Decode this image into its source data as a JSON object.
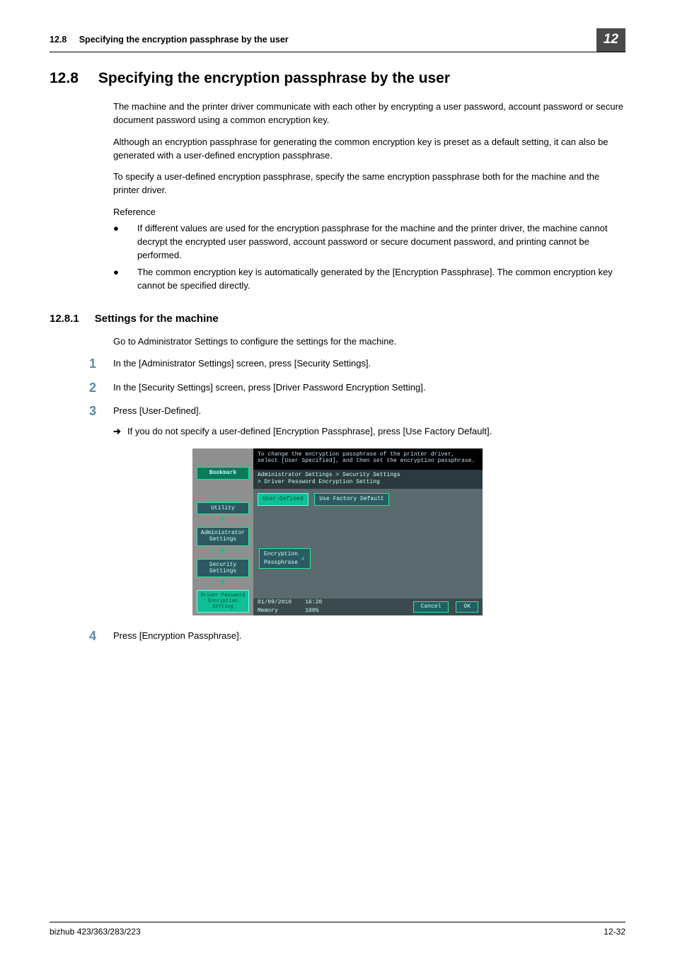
{
  "header": {
    "section_number": "12.8",
    "running_title": "Specifying the encryption passphrase by the user",
    "chapter_badge": "12"
  },
  "h1": {
    "number": "12.8",
    "title": "Specifying the encryption passphrase by the user"
  },
  "intro": {
    "p1": "The machine and the printer driver communicate with each other by encrypting a user password, account password or secure document password using a common encryption key.",
    "p2": "Although an encryption passphrase for generating the common encryption key is preset as a default setting, it can also be generated with a user-defined encryption passphrase.",
    "p3": "To specify a user-defined encryption passphrase, specify the same encryption passphrase both for the machine and the printer driver.",
    "ref_label": "Reference",
    "bullets": [
      "If different values are used for the encryption passphrase for the machine and the printer driver, the machine cannot decrypt the encrypted user password, account password or secure document password, and printing cannot be performed.",
      "The common encryption key is automatically generated by the [Encryption Passphrase]. The common encryption key cannot be specified directly."
    ]
  },
  "h2": {
    "number": "12.8.1",
    "title": "Settings for the machine",
    "lead": "Go to Administrator Settings to configure the settings for the machine."
  },
  "steps": {
    "s1": "In the [Administrator Settings] screen, press [Security Settings].",
    "s2": "In the [Security Settings] screen, press [Driver Password Encryption Setting].",
    "s3": "Press [User-Defined].",
    "s3_sub": "If you do not specify a user-defined [Encryption Passphrase], press [Use Factory Default].",
    "s4": "Press [Encryption Passphrase]."
  },
  "device": {
    "hint_line1": "To change the encryption passphrase of the printer driver,",
    "hint_line2": "select [User Specified], and then set the encryption passphrase.",
    "bookmark": "Bookmark",
    "crumbs": {
      "utility": "Utility",
      "admin": "Administrator\nSettings",
      "security": "Security\nSettings",
      "driver": "Driver Password\nEncryption\nSetting"
    },
    "breadcrumb_line1": "Administrator Settings > Security Settings",
    "breadcrumb_line2": "> Driver Password Encryption Setting",
    "btn_user_defined": "User-Defined",
    "btn_factory": "Use Factory Default",
    "btn_encryption": "Encryption\nPassphrase",
    "footer_date": "01/09/2010",
    "footer_time": "16:20",
    "footer_mem_label": "Memory",
    "footer_mem_value": "100%",
    "btn_cancel": "Cancel",
    "btn_ok": "OK"
  },
  "footer": {
    "model": "bizhub 423/363/283/223",
    "page": "12-32"
  }
}
